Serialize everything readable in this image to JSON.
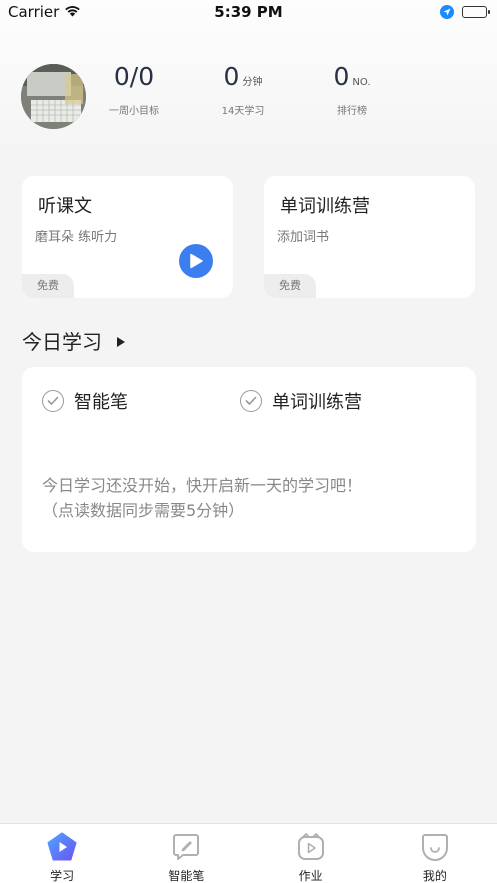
{
  "status_bar": {
    "carrier": "Carrier",
    "time": "5:39 PM"
  },
  "profile": {
    "stats": [
      {
        "value": "0/0",
        "unit": "",
        "label": "一周小目标"
      },
      {
        "value": "0",
        "unit": "分钟",
        "label": "14天学习"
      },
      {
        "value": "0",
        "unit": "NO.",
        "label": "排行榜"
      }
    ]
  },
  "cards": [
    {
      "title": "听课文",
      "subtitle": "磨耳朵 练听力",
      "tag": "免费"
    },
    {
      "title": "单词训练营",
      "subtitle": "添加词书",
      "tag": "免费"
    }
  ],
  "today": {
    "title": "今日学习",
    "items": [
      "智能笔",
      "单词训练营"
    ],
    "message_line1": "今日学习还没开始，快开启新一天的学习吧！",
    "message_line2": "（点读数据同步需要5分钟）"
  },
  "tab_bar": {
    "tabs": [
      {
        "label": "学习",
        "icon": "study-icon"
      },
      {
        "label": "智能笔",
        "icon": "pen-icon"
      },
      {
        "label": "作业",
        "icon": "homework-icon"
      },
      {
        "label": "我的",
        "icon": "profile-icon"
      }
    ]
  },
  "colors": {
    "accent": "#3a7ef0",
    "stat_value": "#283144",
    "tab_inactive": "#b0b0b0"
  }
}
